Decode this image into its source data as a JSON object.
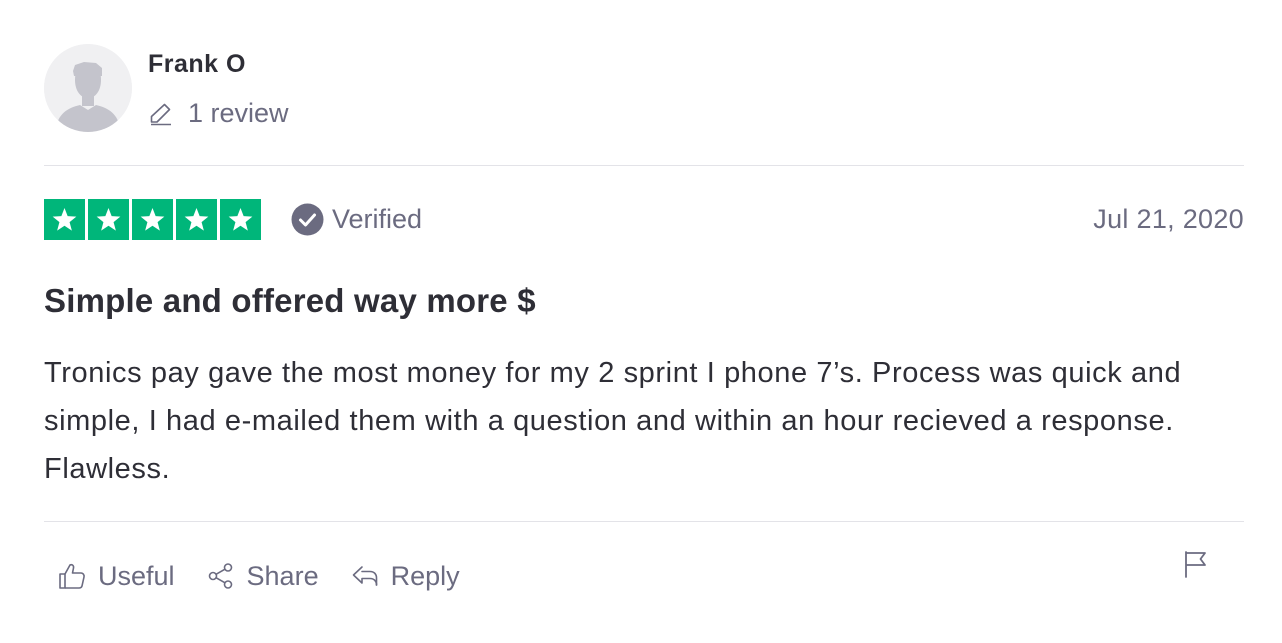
{
  "consumer": {
    "name": "Frank O",
    "review_count_label": "1 review",
    "avatar_icon": "default-user-silhouette",
    "avatar_bg": "#f0f0f2"
  },
  "review": {
    "rating": 5,
    "rating_max": 5,
    "star_color": "#00b67a",
    "verified_label": "Verified",
    "date": "Jul 21, 2020",
    "title": "Simple and offered way more $",
    "text": "Tronics pay gave the most money for my 2 sprint I phone 7’s. Process was quick and simple, I had e-mailed them with a question and within an hour recieved a response. Flawless."
  },
  "actions": {
    "useful_label": "Useful",
    "share_label": "Share",
    "reply_label": "Reply",
    "useful_icon": "thumbs-up-icon",
    "share_icon": "share-icon",
    "reply_icon": "reply-icon",
    "report_icon": "flag-icon"
  },
  "colors": {
    "muted_text": "#6b6b80",
    "primary_text": "#2e2e36",
    "divider": "#e3e3e8"
  }
}
